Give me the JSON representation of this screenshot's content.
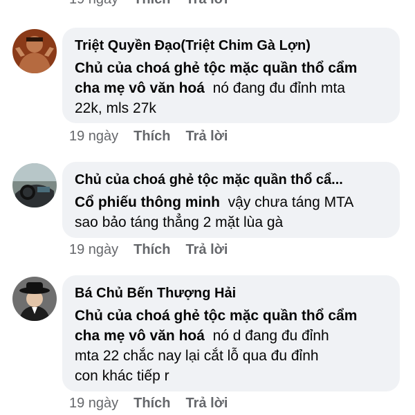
{
  "top_actions": {
    "time": "19 ngày",
    "like": "Thích",
    "reply": "Trả lời"
  },
  "comments": [
    {
      "author": "Triệt Quyền Đạo(Triệt Chim Gà Lợn)",
      "tag_line1": "Chủ của choá ghẻ tộc mặc quần thổ cẩm",
      "tag_line2": "cha mẹ vô văn hoá",
      "text_after_tag": "nó đang đu đỉnh mta",
      "text_line3": "22k, mls 27k",
      "time": "19 ngày",
      "like": "Thích",
      "reply": "Trả lời",
      "avatar_icon": "fighter-avatar"
    },
    {
      "author": "Chủ của choá ghẻ tộc mặc quần thổ cẩ...",
      "tag_line": "Cổ phiếu thông minh",
      "text_after_tag": "vậy chưa táng MTA",
      "text_line2": "sao bảo táng thẳng 2 mặt lùa gà",
      "time": "19 ngày",
      "like": "Thích",
      "reply": "Trả lời",
      "avatar_icon": "car-interior-avatar"
    },
    {
      "author": "Bá Chủ Bến Thượng Hải",
      "tag_line1": "Chủ của choá ghẻ tộc mặc quần thổ cẩm",
      "tag_line2": "cha mẹ vô văn hoá",
      "text_after_tag": "nó d đang đu đỉnh",
      "text_line3": "mta 22 chắc nay lại cắt lỗ qua đu đỉnh",
      "text_line4": "con khác tiếp r",
      "time": "19 ngày",
      "like": "Thích",
      "reply": "Trả lời",
      "avatar_icon": "hat-man-avatar"
    }
  ]
}
